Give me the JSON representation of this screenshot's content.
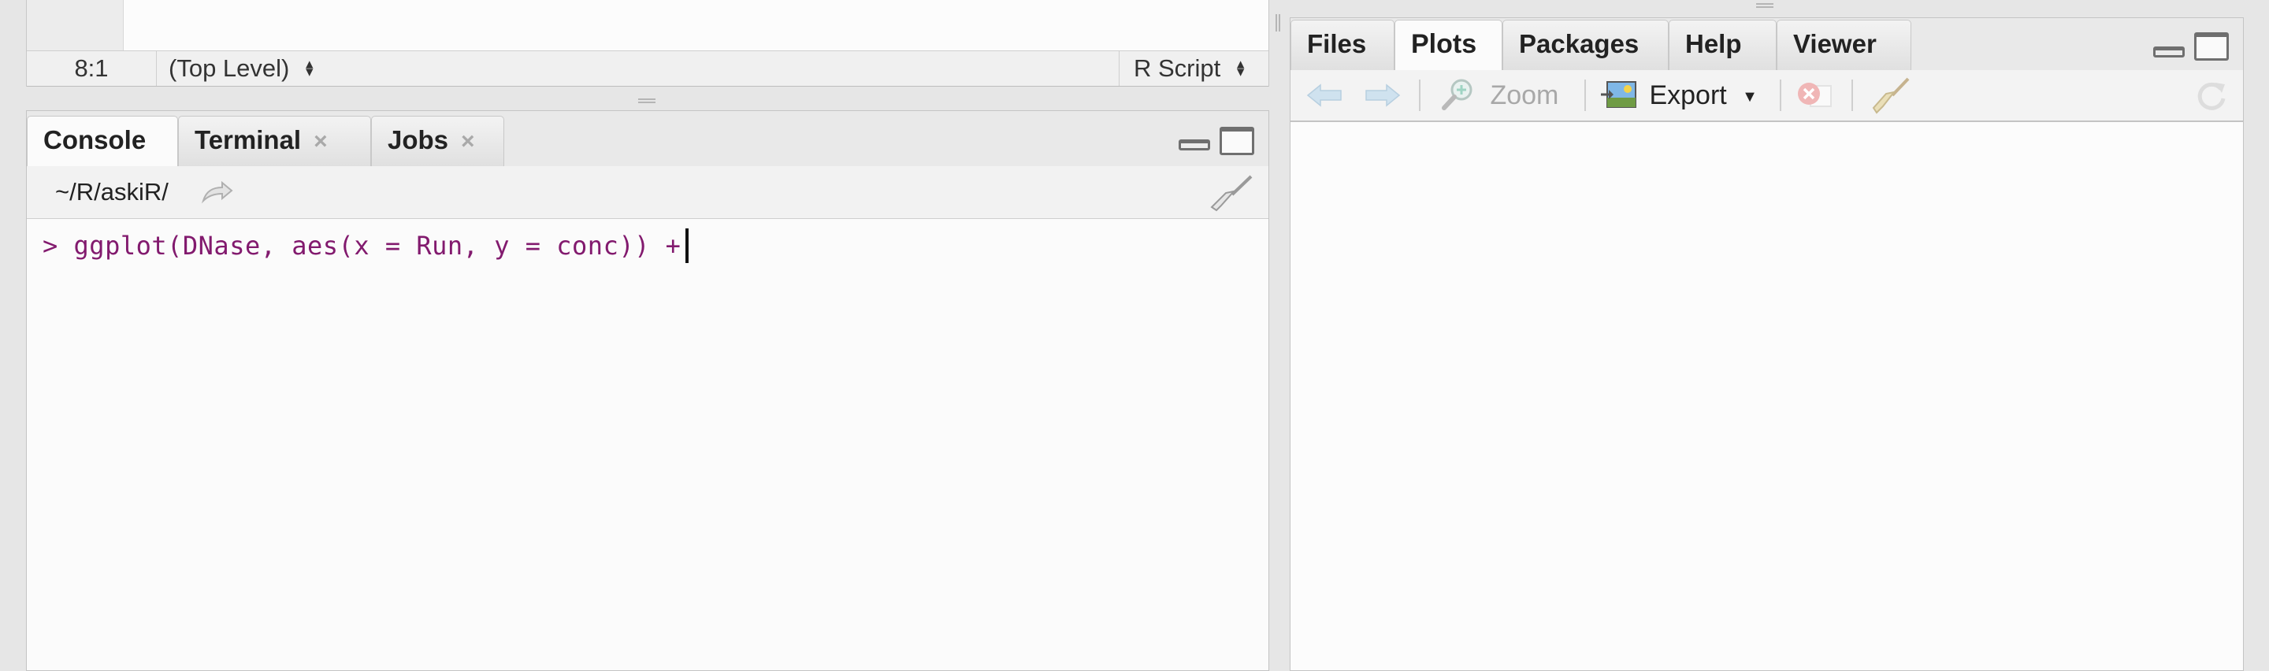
{
  "editor": {
    "status": {
      "position": "8:1",
      "scope": "(Top Level)",
      "file_type": "R Script"
    }
  },
  "console_pane": {
    "tabs": [
      {
        "label": "Console",
        "closable": false,
        "active": true
      },
      {
        "label": "Terminal",
        "closable": true,
        "active": false
      },
      {
        "label": "Jobs",
        "closable": true,
        "active": false
      }
    ],
    "close_glyph": "×",
    "path": "~/R/askiR/",
    "prompt": ">",
    "command": "ggplot(DNase, aes(x = Run, y = conc)) +"
  },
  "right_pane": {
    "tabs": [
      {
        "label": "Files",
        "active": false
      },
      {
        "label": "Plots",
        "active": true
      },
      {
        "label": "Packages",
        "active": false
      },
      {
        "label": "Help",
        "active": false
      },
      {
        "label": "Viewer",
        "active": false
      }
    ],
    "toolbar": {
      "zoom_label": "Zoom",
      "export_label": "Export"
    }
  },
  "icons": {
    "back": "back-arrow-icon",
    "forward": "forward-arrow-icon",
    "zoom": "magnifier-icon",
    "export": "export-image-icon",
    "remove": "remove-plot-icon",
    "clear": "broom-icon",
    "refresh": "refresh-icon",
    "go_to_dir": "go-to-directory-icon"
  },
  "colors": {
    "console_text": "#821a6e",
    "pane_background": "#fbfbfb",
    "tab_bar": "#e9e9e9"
  }
}
